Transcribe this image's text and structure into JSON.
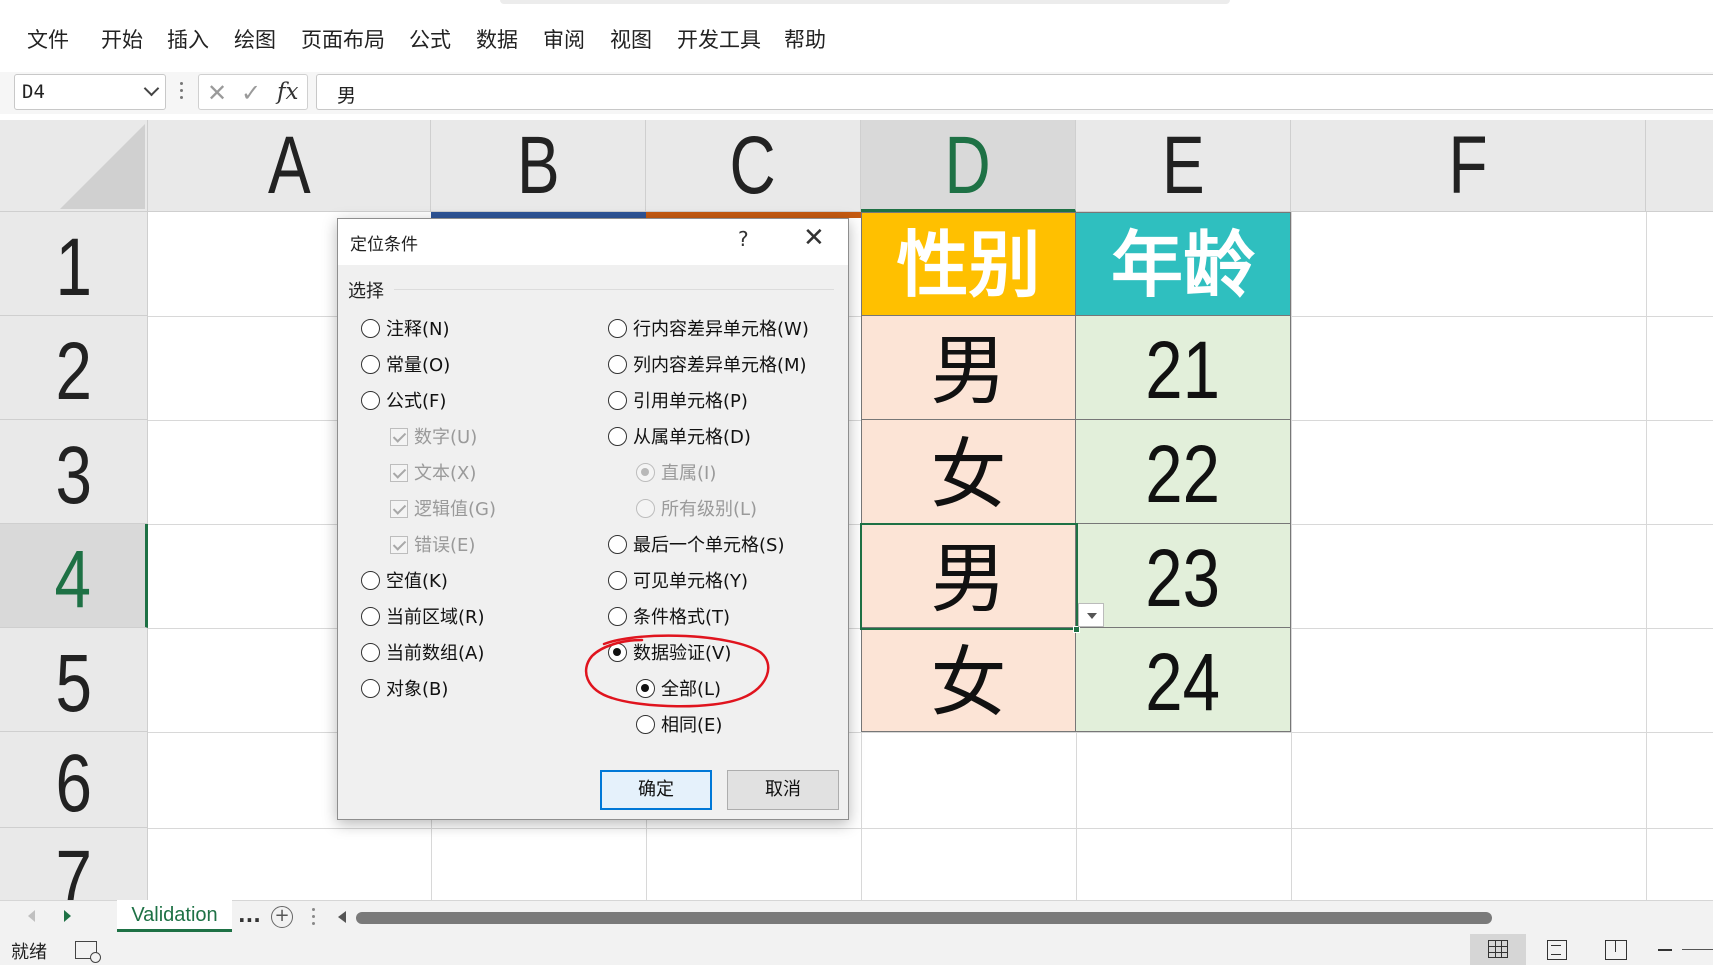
{
  "menu": [
    "文件",
    "开始",
    "插入",
    "绘图",
    "页面布局",
    "公式",
    "数据",
    "审阅",
    "视图",
    "开发工具",
    "帮助"
  ],
  "formula_bar": {
    "name_box": "D4",
    "value": "男"
  },
  "columns": [
    "A",
    "B",
    "C",
    "D",
    "E",
    "F"
  ],
  "rows": [
    "1",
    "2",
    "3",
    "4",
    "5",
    "6",
    "7"
  ],
  "table": {
    "header_gender": "性别",
    "header_age": "年龄",
    "gender": [
      "男",
      "女",
      "男",
      "女"
    ],
    "age": [
      "21",
      "22",
      "23",
      "24"
    ]
  },
  "dialog": {
    "title": "定位条件",
    "help": "?",
    "close": "✕",
    "group_label": "选择",
    "left_options": [
      {
        "label": "注释(N)",
        "type": "radio",
        "checked": false,
        "disabled": false
      },
      {
        "label": "常量(O)",
        "type": "radio",
        "checked": false,
        "disabled": false
      },
      {
        "label": "公式(F)",
        "type": "radio",
        "checked": false,
        "disabled": false
      },
      {
        "label": "数字(U)",
        "type": "checkbox",
        "checked": true,
        "disabled": true
      },
      {
        "label": "文本(X)",
        "type": "checkbox",
        "checked": true,
        "disabled": true
      },
      {
        "label": "逻辑值(G)",
        "type": "checkbox",
        "checked": true,
        "disabled": true
      },
      {
        "label": "错误(E)",
        "type": "checkbox",
        "checked": true,
        "disabled": true
      },
      {
        "label": "空值(K)",
        "type": "radio",
        "checked": false,
        "disabled": false
      },
      {
        "label": "当前区域(R)",
        "type": "radio",
        "checked": false,
        "disabled": false
      },
      {
        "label": "当前数组(A)",
        "type": "radio",
        "checked": false,
        "disabled": false
      },
      {
        "label": "对象(B)",
        "type": "radio",
        "checked": false,
        "disabled": false
      }
    ],
    "right_options": [
      {
        "label": "行内容差异单元格(W)",
        "type": "radio",
        "checked": false,
        "disabled": false
      },
      {
        "label": "列内容差异单元格(M)",
        "type": "radio",
        "checked": false,
        "disabled": false
      },
      {
        "label": "引用单元格(P)",
        "type": "radio",
        "checked": false,
        "disabled": false
      },
      {
        "label": "从属单元格(D)",
        "type": "radio",
        "checked": false,
        "disabled": false
      },
      {
        "label": "直属(I)",
        "type": "radio",
        "checked": true,
        "disabled": true
      },
      {
        "label": "所有级别(L)",
        "type": "radio",
        "checked": false,
        "disabled": true
      },
      {
        "label": "最后一个单元格(S)",
        "type": "radio",
        "checked": false,
        "disabled": false
      },
      {
        "label": "可见单元格(Y)",
        "type": "radio",
        "checked": false,
        "disabled": false
      },
      {
        "label": "条件格式(T)",
        "type": "radio",
        "checked": false,
        "disabled": false
      },
      {
        "label": "数据验证(V)",
        "type": "radio",
        "checked": true,
        "disabled": false
      },
      {
        "label": "全部(L)",
        "type": "radio",
        "checked": true,
        "disabled": false
      },
      {
        "label": "相同(E)",
        "type": "radio",
        "checked": false,
        "disabled": false
      }
    ],
    "ok_label": "确定",
    "cancel_label": "取消"
  },
  "sheet_tab": {
    "name": "Validation",
    "more": "...",
    "add": "+"
  },
  "status": {
    "text": "就绪"
  },
  "colors": {
    "gender_header": "#ffc000",
    "age_header": "#2fbfbf",
    "gender_cell": "#fce4d6",
    "age_cell": "#e2efda",
    "excel_green": "#1e7145",
    "annotation_red": "#e0141e"
  }
}
